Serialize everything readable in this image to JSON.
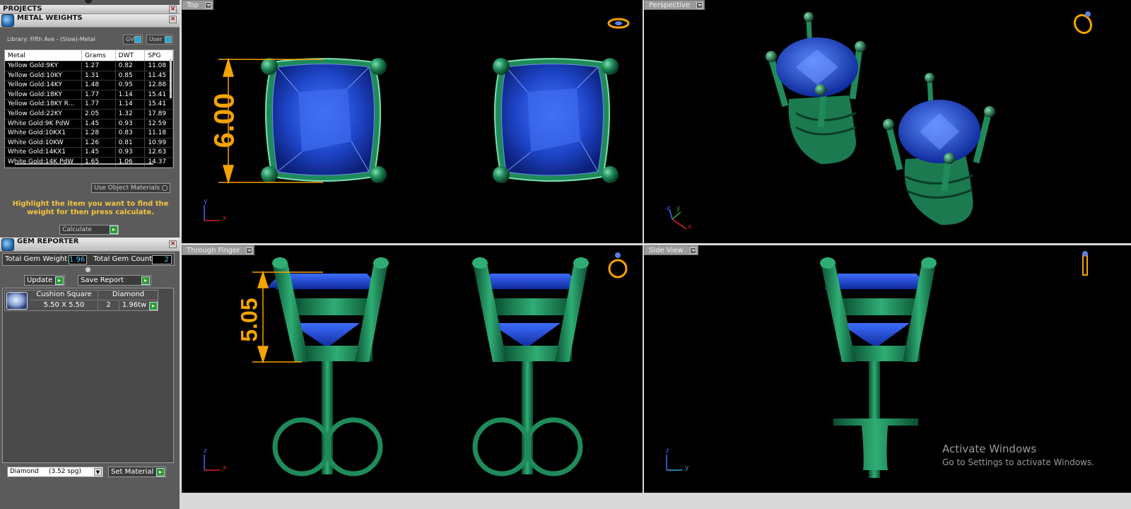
{
  "projects_panel": {
    "title": "PROJECTS"
  },
  "metal_weights": {
    "title": "METAL WEIGHTS",
    "library": "Library: Fifth Ave - (Slow)-Metal",
    "gv_label": "GV",
    "user_label": "User",
    "columns": [
      "Metal",
      "Grams",
      "DWT",
      "SPG"
    ],
    "rows": [
      [
        "Yellow Gold:9KY",
        "1.27",
        "0.82",
        "11.08"
      ],
      [
        "Yellow Gold:10KY",
        "1.31",
        "0.85",
        "11.45"
      ],
      [
        "Yellow Gold:14KY",
        "1.48",
        "0.95",
        "12.88"
      ],
      [
        "Yellow Gold:18KY",
        "1.77",
        "1.14",
        "15.41"
      ],
      [
        "Yellow Gold:18KY R...",
        "1.77",
        "1.14",
        "15.41"
      ],
      [
        "Yellow Gold:22KY",
        "2.05",
        "1.32",
        "17.89"
      ],
      [
        "White Gold:9K PdW",
        "1.45",
        "0.93",
        "12.59"
      ],
      [
        "White Gold:10KX1",
        "1.28",
        "0.83",
        "11.18"
      ],
      [
        "White Gold:10KW",
        "1.26",
        "0.81",
        "10.99"
      ],
      [
        "White Gold:14KX1",
        "1.45",
        "0.93",
        "12.63"
      ],
      [
        "White Gold:14K PdW",
        "1.65",
        "1.06",
        "14.37"
      ]
    ],
    "use_object_materials": "Use Object Materials",
    "hint": "Highlight the item you want to find the weight for then press calculate.",
    "calculate": "Calculate"
  },
  "gem_reporter": {
    "title": "GEM REPORTER",
    "total_weight_label": "Total Gem Weight",
    "total_weight_value": "1.96",
    "total_count_label": "Total Gem Count",
    "total_count_value": "2",
    "update": "Update",
    "save_report": "Save Report",
    "gem": {
      "shape": "Cushion Square",
      "material": "Diamond",
      "size": "5.50 X 5.50",
      "count": "2",
      "weight": "1.96tw"
    },
    "material_select": "Diamond     (3.52 spg)",
    "set_material": "Set Material"
  },
  "viewports": {
    "top": {
      "label": "Top",
      "dimension": "6.00"
    },
    "perspective": {
      "label": "Perspective"
    },
    "through_finger": {
      "label": "Through Finger",
      "dimension": "5.05"
    },
    "side": {
      "label": "Side View"
    }
  },
  "axis_labels": {
    "x": "x",
    "y": "y",
    "z": "z"
  },
  "watermark": {
    "line1": "Activate Windows",
    "line2": "Go to Settings to activate Windows."
  },
  "colors": {
    "metal": "#1f8a5a",
    "gem": "#1d3fb5",
    "dimension": "#f5a300",
    "axis_red": "#e02020",
    "axis_blue": "#3a6cff",
    "axis_green": "#2ea02e"
  }
}
